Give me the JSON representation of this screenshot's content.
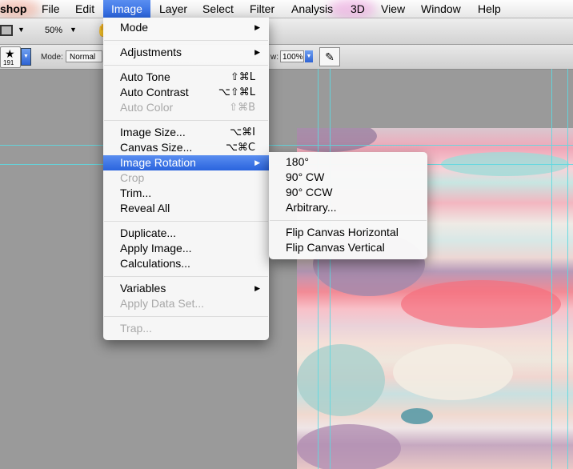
{
  "menubar": {
    "items": [
      "shop",
      "File",
      "Edit",
      "Image",
      "Layer",
      "Select",
      "Filter",
      "Analysis",
      "3D",
      "View",
      "Window",
      "Help"
    ]
  },
  "toolbar": {
    "zoom": "50%",
    "brush_size": "191",
    "mode_label": "Mode:",
    "mode_value": "Normal",
    "flow_label": "w:",
    "flow_value": "100%"
  },
  "image_menu": {
    "mode": "Mode",
    "adjustments": "Adjustments",
    "auto_tone": "Auto Tone",
    "auto_tone_sc": "⇧⌘L",
    "auto_contrast": "Auto Contrast",
    "auto_contrast_sc": "⌥⇧⌘L",
    "auto_color": "Auto Color",
    "auto_color_sc": "⇧⌘B",
    "image_size": "Image Size...",
    "image_size_sc": "⌥⌘I",
    "canvas_size": "Canvas Size...",
    "canvas_size_sc": "⌥⌘C",
    "image_rotation": "Image Rotation",
    "crop": "Crop",
    "trim": "Trim...",
    "reveal_all": "Reveal All",
    "duplicate": "Duplicate...",
    "apply_image": "Apply Image...",
    "calculations": "Calculations...",
    "variables": "Variables",
    "apply_data_set": "Apply Data Set...",
    "trap": "Trap..."
  },
  "rotation_submenu": {
    "r180": "180°",
    "cw": "90° CW",
    "ccw": "90° CCW",
    "arbitrary": "Arbitrary...",
    "flip_h": "Flip Canvas Horizontal",
    "flip_v": "Flip Canvas Vertical"
  }
}
